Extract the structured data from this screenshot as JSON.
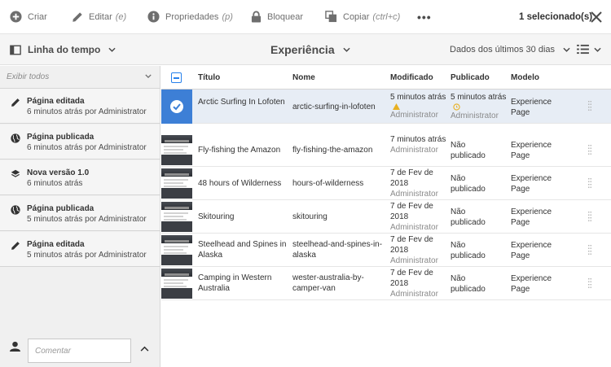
{
  "actionbar": {
    "create_label": "Criar",
    "edit_label": "Editar",
    "edit_shortcut": "(e)",
    "properties_label": "Propriedades",
    "properties_shortcut": "(p)",
    "lock_label": "Bloquear",
    "copy_label": "Copiar",
    "copy_shortcut": "(ctrl+c)",
    "more_label": "•••",
    "selection_count": "1 selecionado(s)"
  },
  "navbar": {
    "rail_label": "Linha do tempo",
    "view_title": "Experiência",
    "date_filter": "Dados dos últimos 30 dias"
  },
  "timeline": {
    "filter_label": "Exibir todos",
    "items": [
      {
        "icon": "pencil-icon",
        "title": "Página editada",
        "detail": "6 minutos atrás por Administrator"
      },
      {
        "icon": "globe-icon",
        "title": "Página publicada",
        "detail": "6 minutos atrás por Administrator"
      },
      {
        "icon": "layers-icon",
        "title": "Nova versão 1.0",
        "detail": "6 minutos atrás"
      },
      {
        "icon": "globe-icon",
        "title": "Página publicada",
        "detail": "5 minutos atrás por Administrator"
      },
      {
        "icon": "pencil-icon",
        "title": "Página editada",
        "detail": "5 minutos atrás por Administrator"
      }
    ],
    "comment_placeholder": "Comentar"
  },
  "table": {
    "headers": {
      "title": "Título",
      "name": "Nome",
      "modified": "Modificado",
      "published": "Publicado",
      "model": "Modelo"
    },
    "rows": [
      {
        "title": "Arctic Surfing In Lofoten",
        "name": "arctic-surfing-in-lofoten",
        "modified": "5 minutos atrás",
        "modified_by": "Administrator",
        "published": "5 minutos atrás",
        "published_by": "Administrator",
        "model": "Experience Page",
        "selected": true
      },
      {
        "title": "Fly-fishing the Amazon",
        "name": "fly-fishing-the-amazon",
        "modified": "7 minutos atrás",
        "modified_by": "Administrator",
        "published": "Não publicado",
        "model": "Experience Page"
      },
      {
        "title": "48 hours of Wilderness",
        "name": "hours-of-wilderness",
        "modified": "7 de Fev de 2018",
        "modified_by": "Administrator",
        "published": "Não publicado",
        "model": "Experience Page"
      },
      {
        "title": "Skitouring",
        "name": "skitouring",
        "modified": "7 de Fev de 2018",
        "modified_by": "Administrator",
        "published": "Não publicado",
        "model": "Experience Page"
      },
      {
        "title": "Steelhead and Spines in Alaska",
        "name": "steelhead-and-spines-in-alaska",
        "modified": "7 de Fev de 2018",
        "modified_by": "Administrator",
        "published": "Não publicado",
        "model": "Experience Page"
      },
      {
        "title": "Camping in Western Australia",
        "name": "wester-australia-by-camper-van",
        "modified": "7 de Fev de 2018",
        "modified_by": "Administrator",
        "published": "Não publicado",
        "model": "Experience Page"
      }
    ]
  },
  "colors": {
    "accent": "#2680eb",
    "selection": "#3d7fd6",
    "warning": "#e8b021"
  }
}
